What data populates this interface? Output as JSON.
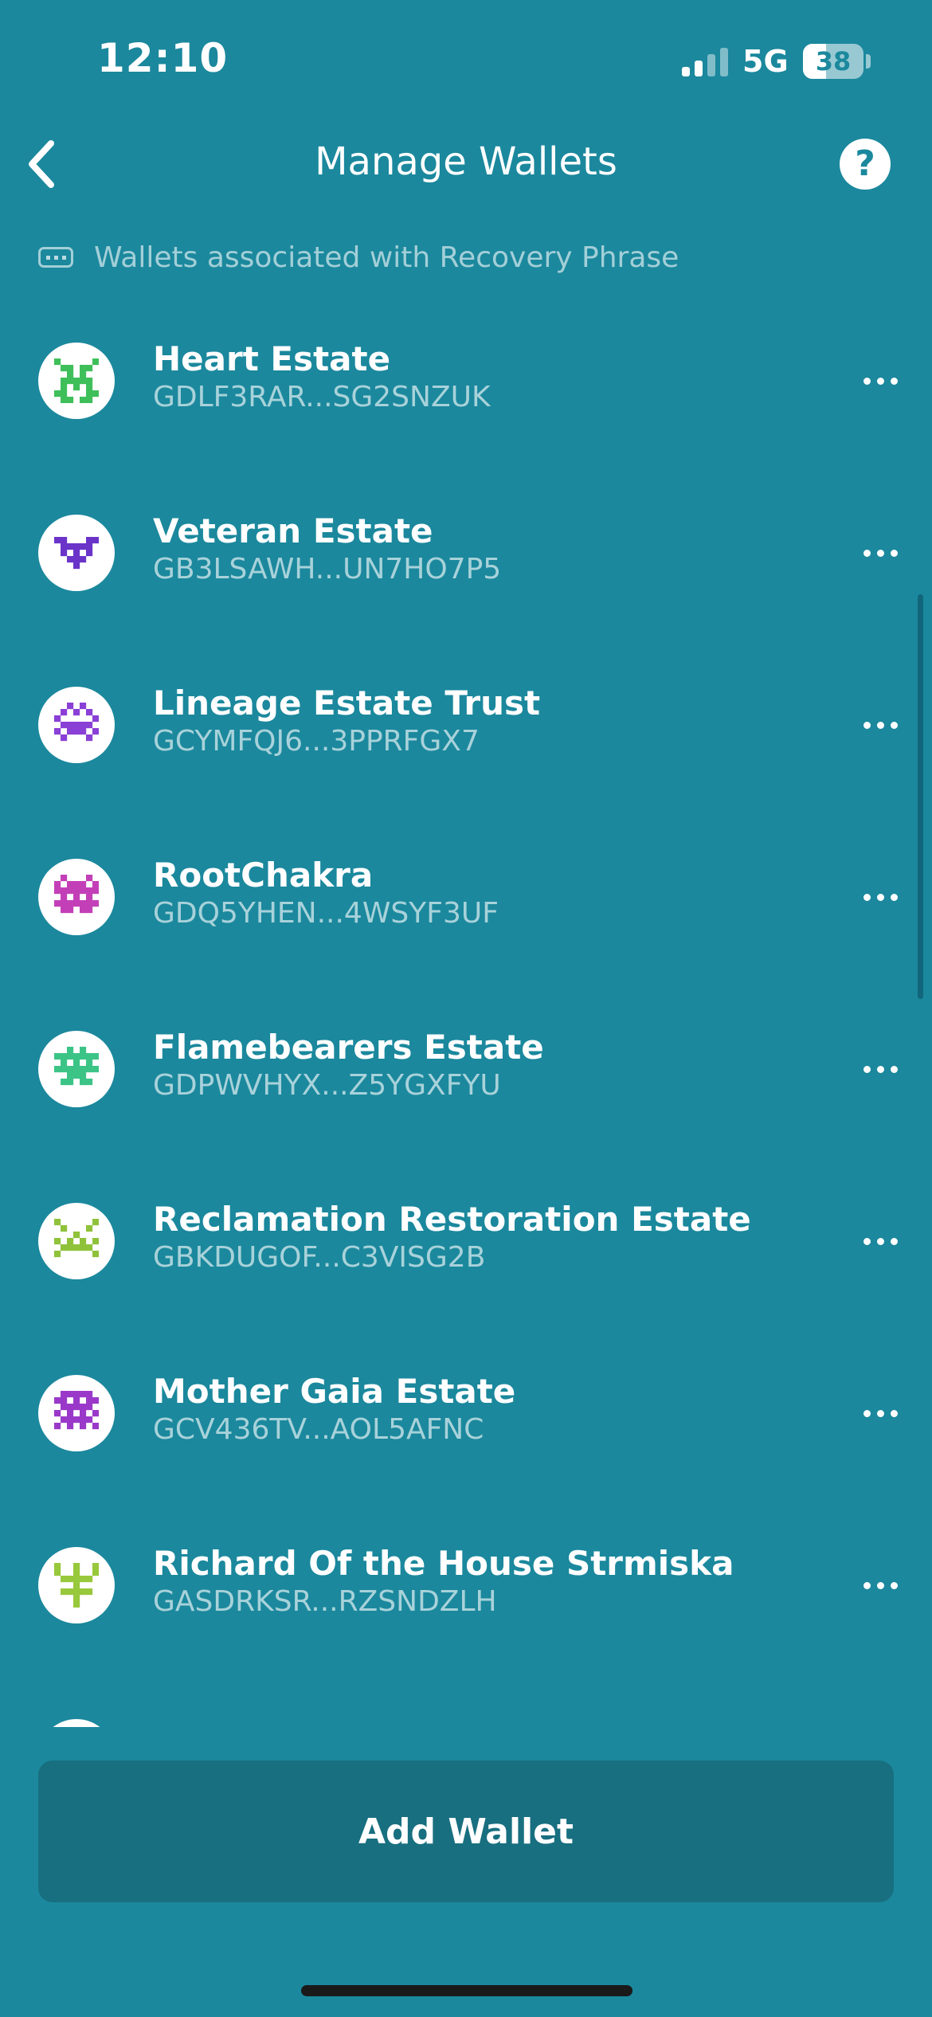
{
  "status_bar": {
    "time": "12:10",
    "network": "5G",
    "battery_percent": "38",
    "signal_bars_active": 2,
    "signal_bars_total": 4
  },
  "header": {
    "title": "Manage Wallets",
    "back_icon": "chevron-left-icon",
    "help_label": "?"
  },
  "section": {
    "icon": "keyboard-icon",
    "label": "Wallets associated with Recovery Phrase"
  },
  "wallets": [
    {
      "name": "Heart Estate",
      "address": "GDLF3RAR...SG2SNZUK",
      "avatar_color": "#3fbf5a"
    },
    {
      "name": "Veteran Estate",
      "address": "GB3LSAWH...UN7HO7P5",
      "avatar_color": "#6a34c9"
    },
    {
      "name": "Lineage Estate Trust",
      "address": "GCYMFQJ6...3PPRFGX7",
      "avatar_color": "#8a3fd6"
    },
    {
      "name": "RootChakra",
      "address": "GDQ5YHEN...4WSYF3UF",
      "avatar_color": "#c33fb8"
    },
    {
      "name": "Flamebearers Estate",
      "address": "GDPWVHYX...Z5YGXFYU",
      "avatar_color": "#3cc487"
    },
    {
      "name": "Reclamation Restoration Estate",
      "address": "GBKDUGOF...C3VISG2B",
      "avatar_color": "#8fc23a"
    },
    {
      "name": "Mother Gaia Estate",
      "address": "GCV436TV...AOL5AFNC",
      "avatar_color": "#9a39c9"
    },
    {
      "name": "Richard Of the House Strmiska",
      "address": "GASDRKSR...RZSNDZLH",
      "avatar_color": "#98c83b"
    }
  ],
  "footer": {
    "add_wallet_label": "Add Wallet"
  },
  "colors": {
    "background": "#1b889d",
    "button": "#186f80"
  }
}
